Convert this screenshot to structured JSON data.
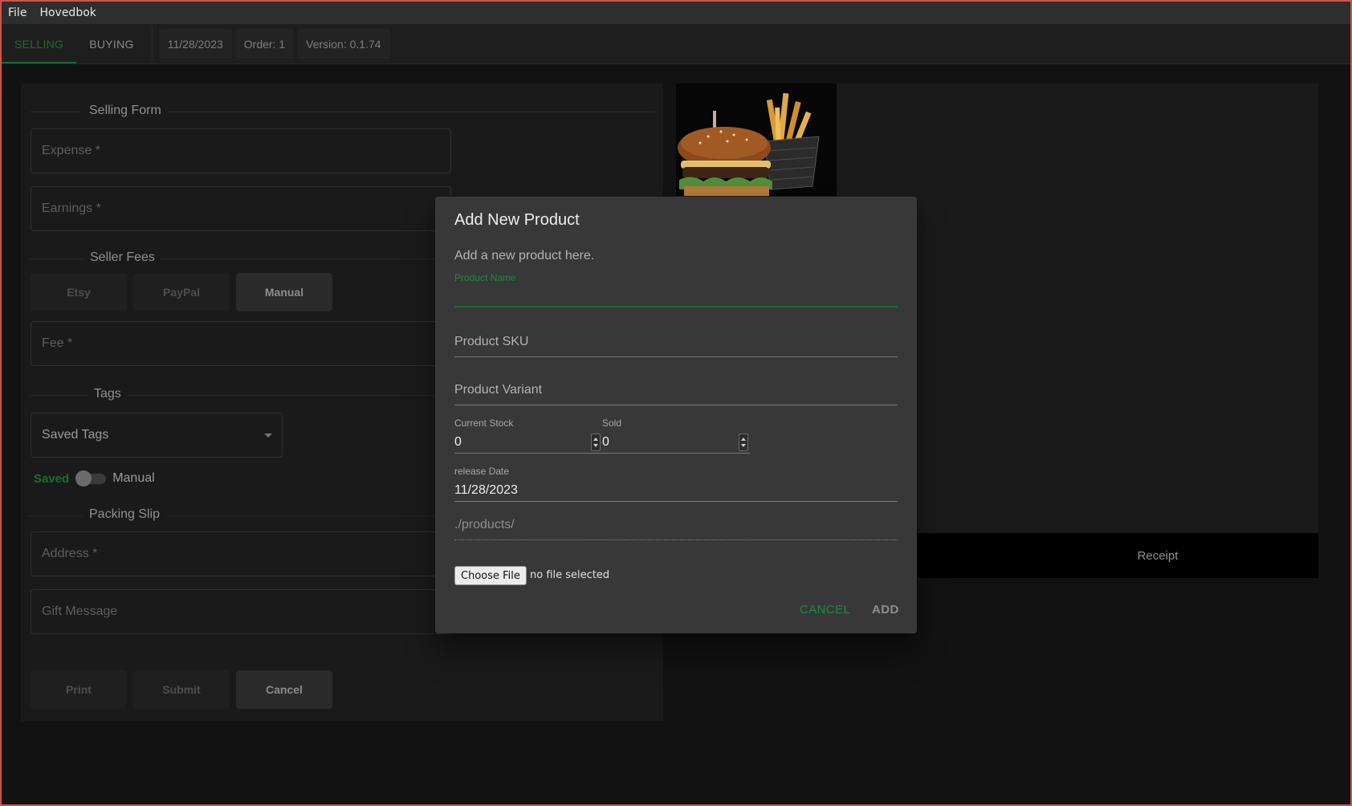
{
  "menu": {
    "items": [
      "File",
      "Hovedbok"
    ]
  },
  "tabs": [
    {
      "label": "SELLING",
      "active": true
    },
    {
      "label": "BUYING",
      "active": false
    }
  ],
  "status_chips": {
    "date": "11/28/2023",
    "order": "Order: 1",
    "version": "Version: 0.1.74"
  },
  "selling_form": {
    "title": "Selling Form",
    "expense_label": "Expense *",
    "earnings_label": "Earnings *"
  },
  "seller_fees": {
    "title": "Seller Fees",
    "buttons": [
      "Etsy",
      "PayPal",
      "Manual"
    ],
    "fee_label": "Fee *"
  },
  "tags": {
    "title": "Tags",
    "select_label": "Saved Tags",
    "toggle_left": "Saved",
    "toggle_right": "Manual"
  },
  "packing_slip": {
    "title": "Packing Slip",
    "address_label": "Address *",
    "gift_label": "Gift Message"
  },
  "form_actions": {
    "print": "Print",
    "submit": "Submit",
    "cancel": "Cancel"
  },
  "receipt": {
    "label": "Receipt"
  },
  "dialog": {
    "title": "Add New Product",
    "subtitle": "Add a new product here.",
    "product_name_label": "Product Name",
    "product_sku_placeholder": "Product SKU",
    "product_variant_placeholder": "Product Variant",
    "current_stock_label": "Current Stock",
    "current_stock_value": "0",
    "sold_label": "Sold",
    "sold_value": "0",
    "release_date_label": "release Date",
    "release_date_value": "11/28/2023",
    "path_value": "./products/",
    "file_button": "Choose File",
    "file_status": "no file selected",
    "cancel": "CANCEL",
    "add": "ADD"
  },
  "colors": {
    "accent": "#1d6b33",
    "background": "#121212",
    "dialog": "#383838",
    "window_border": "#c9564a"
  }
}
